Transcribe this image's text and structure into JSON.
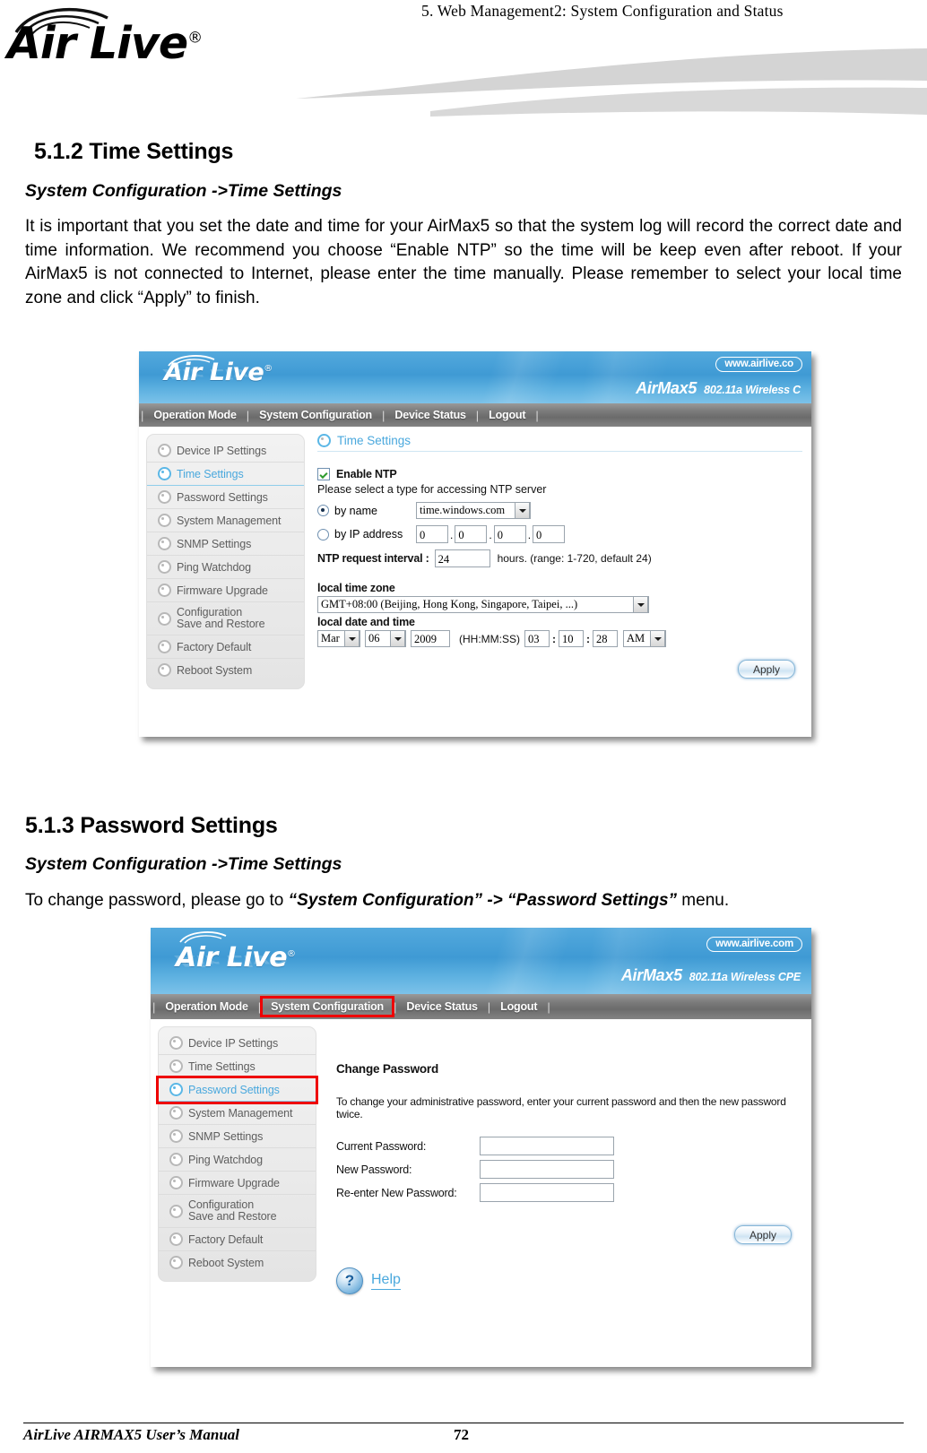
{
  "page": {
    "running_head": "5.   Web Management2: System Configuration and Status",
    "logo_text": "Air Live",
    "footer_title": "AirLive AIRMAX5 User’s Manual",
    "footer_page": "72"
  },
  "section_time": {
    "heading": "5.1.2 Time Settings",
    "subheading": "System Configuration ->Time Settings",
    "paragraph": "It is important that you set the date and time for your AirMax5 so that the system log will record the correct date and time information.    We recommend you choose “Enable NTP” so the time will be keep even after reboot.    If your AirMax5 is not connected to Internet, please enter the time manually.    Please remember to select your local time zone and click “Apply” to finish."
  },
  "section_password": {
    "heading": "5.1.3 Password Settings",
    "subheading": "System Configuration ->Time Settings",
    "paragraph_pre": "To change password, please go to ",
    "paragraph_em1": "“System Configuration” -> “Password Settings”",
    "paragraph_post": " menu."
  },
  "shot_time": {
    "banner": {
      "logo": "Air Live",
      "url_badge": "www.airlive.co",
      "model": "AirMax5",
      "model_desc": "802.11a Wireless C"
    },
    "nav": [
      {
        "label": "Operation Mode",
        "highlight": false
      },
      {
        "label": "System Configuration",
        "highlight": false
      },
      {
        "label": "Device Status",
        "highlight": false
      },
      {
        "label": "Logout",
        "highlight": false
      }
    ],
    "sidebar": [
      {
        "label": "Device IP Settings",
        "active": false,
        "boxed": false
      },
      {
        "label": "Time Settings",
        "active": true,
        "boxed": false
      },
      {
        "label": "Password Settings",
        "active": false,
        "boxed": false
      },
      {
        "label": "System Management",
        "active": false,
        "boxed": false
      },
      {
        "label": "SNMP Settings",
        "active": false,
        "boxed": false
      },
      {
        "label": "Ping Watchdog",
        "active": false,
        "boxed": false
      },
      {
        "label": "Firmware Upgrade",
        "active": false,
        "boxed": false
      },
      {
        "label": "Configuration",
        "label2": "Save and Restore",
        "active": false,
        "boxed": false
      },
      {
        "label": "Factory Default",
        "active": false,
        "boxed": false
      },
      {
        "label": "Reboot System",
        "active": false,
        "boxed": false
      }
    ],
    "main": {
      "title": "Time Settings",
      "enable_ntp_label": "Enable NTP",
      "enable_ntp_checked": true,
      "type_note": "Please select a type for accessing NTP server",
      "by_name_label": "by name",
      "by_name_selected": true,
      "ntp_server": "time.windows.com",
      "by_ip_label": "by IP address",
      "by_ip_selected": false,
      "ip_octets": [
        "0",
        "0",
        "0",
        "0"
      ],
      "interval_label": "NTP request interval :",
      "interval_value": "24",
      "interval_note": "hours. (range: 1-720, default 24)",
      "timezone_label": "local time zone",
      "timezone_value": "GMT+08:00 (Beijing, Hong Kong, Singapore, Taipei, ...)",
      "datetime_label": "local date and time",
      "month": "Mar",
      "day": "06",
      "year": "2009",
      "time_format_note": "(HH:MM:SS)",
      "hour": "03",
      "minute": "10",
      "second": "28",
      "meridiem": "AM",
      "apply_label": "Apply"
    }
  },
  "shot_password": {
    "banner": {
      "logo": "Air Live",
      "url_badge": "www.airlive.com",
      "model": "AirMax5",
      "model_desc": "802.11a Wireless CPE"
    },
    "nav": [
      {
        "label": "Operation Mode",
        "highlight": false
      },
      {
        "label": "System Configuration",
        "highlight": true
      },
      {
        "label": "Device Status",
        "highlight": false
      },
      {
        "label": "Logout",
        "highlight": false
      }
    ],
    "sidebar": [
      {
        "label": "Device IP Settings",
        "active": false,
        "boxed": false
      },
      {
        "label": "Time Settings",
        "active": false,
        "boxed": false
      },
      {
        "label": "Password Settings",
        "active": true,
        "boxed": true
      },
      {
        "label": "System Management",
        "active": false,
        "boxed": false
      },
      {
        "label": "SNMP Settings",
        "active": false,
        "boxed": false
      },
      {
        "label": "Ping Watchdog",
        "active": false,
        "boxed": false
      },
      {
        "label": "Firmware Upgrade",
        "active": false,
        "boxed": false
      },
      {
        "label": "Configuration",
        "label2": "Save and Restore",
        "active": false,
        "boxed": false
      },
      {
        "label": "Factory Default",
        "active": false,
        "boxed": false
      },
      {
        "label": "Reboot System",
        "active": false,
        "boxed": false
      }
    ],
    "main": {
      "title": "Change Password",
      "note": "To change your administrative password, enter your current password and then the new password twice.",
      "fields": [
        {
          "label": "Current Password:",
          "value": ""
        },
        {
          "label": "New Password:",
          "value": ""
        },
        {
          "label": "Re-enter New Password:",
          "value": ""
        }
      ],
      "apply_label": "Apply",
      "help_label": "Help",
      "help_glyph": "?"
    }
  },
  "colors": {
    "banner_blue": "#4aa2d8",
    "nav_gray": "#7d7d7d",
    "accent_cyan": "#4aa8dd",
    "highlight_red": "#ee0000"
  }
}
